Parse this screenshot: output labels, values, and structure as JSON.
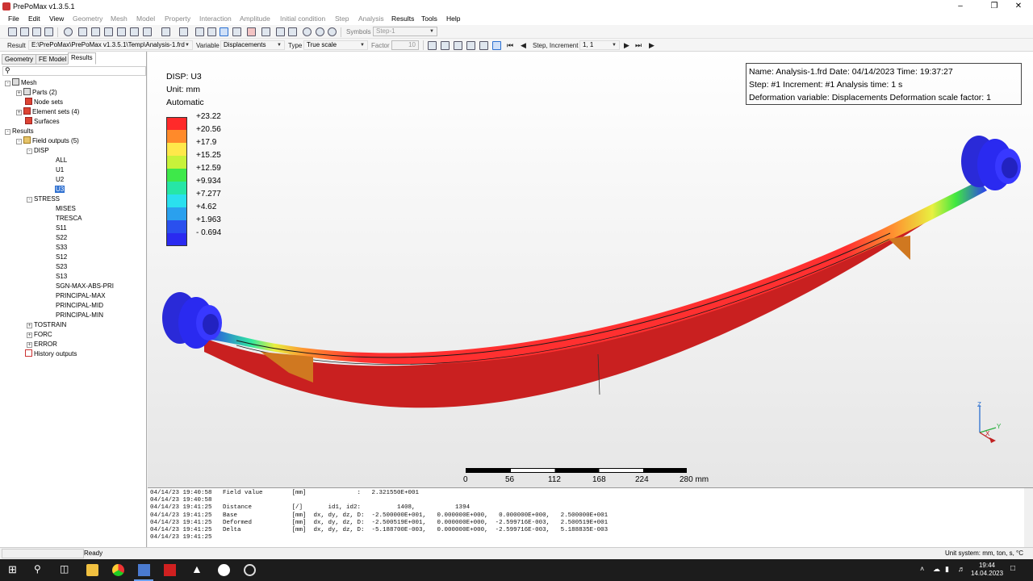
{
  "window": {
    "title": "PrePoMax v1.3.5.1",
    "minimize_icon": "minimize-icon",
    "maximize_icon": "restore-icon",
    "close_icon": "close-icon"
  },
  "menu": [
    "File",
    "Edit",
    "View",
    "Geometry",
    "Mesh",
    "Model",
    "Property",
    "Interaction",
    "Amplitude",
    "Initial condition",
    "Step",
    "Analysis",
    "Results",
    "Tools",
    "Help"
  ],
  "toolbar1": {
    "symbols_label": "Symbols",
    "step_value": "Step-1"
  },
  "toolbar2": {
    "result_label": "Result",
    "result_path": "E:\\PrePoMax\\PrePoMax v1.3.5.1\\Temp\\Analysis-1.frd",
    "variable_label": "Variable",
    "variable_value": "Displacements",
    "type_label": "Type",
    "type_value": "True scale",
    "factor_label": "Factor",
    "factor_value": "10",
    "step_inc_label": "Step, Increment",
    "step_inc_value": "1, 1"
  },
  "tabs": [
    "Geometry",
    "FE Model",
    "Results"
  ],
  "tree": {
    "mesh": "Mesh",
    "parts": "Parts (2)",
    "node_sets": "Node sets",
    "element_sets": "Element sets (4)",
    "surfaces": "Surfaces",
    "results": "Results",
    "field_outputs": "Field outputs (5)",
    "disp": "DISP",
    "disp_items": [
      "ALL",
      "U1",
      "U2",
      "U3"
    ],
    "stress": "STRESS",
    "stress_items": [
      "MISES",
      "TRESCA",
      "S11",
      "S22",
      "S33",
      "S12",
      "S23",
      "S13",
      "SGN-MAX-ABS-PRI",
      "PRINCIPAL-MAX",
      "PRINCIPAL-MID",
      "PRINCIPAL-MIN"
    ],
    "tostrain": "TOSTRAIN",
    "forc": "FORC",
    "error": "ERROR",
    "history_outputs": "History outputs"
  },
  "legend": {
    "title": "DISP: U3",
    "unit": "Unit: mm",
    "mode": "Automatic",
    "values": [
      "+23.22",
      "+20.56",
      "+17.9",
      "+15.25",
      "+12.59",
      "+9.934",
      "+7.277",
      "+4.62",
      "+1.963",
      "- 0.694"
    ],
    "colors": [
      "#ff2a2a",
      "#ff8a2a",
      "#ffe84a",
      "#c8f23a",
      "#3ee84a",
      "#26e6a6",
      "#2ae0ee",
      "#2aa0ee",
      "#2a50ee",
      "#2a2af0"
    ]
  },
  "info": {
    "line1": "Name: Analysis-1.frd   Date: 04/14/2023   Time: 19:37:27",
    "line2": "Step: #1   Increment: #1   Analysis time: 1 s",
    "line3": "Deformation variable: Displacements   Deformation scale factor: 1"
  },
  "scalebar": {
    "labels": [
      "0",
      "56",
      "112",
      "168",
      "224",
      "280 mm"
    ]
  },
  "triad": {
    "x": "X",
    "y": "Y",
    "z": "Z"
  },
  "console": [
    "04/14/23 19:40:58   Field value        [mm]              :   2.321550E+001",
    "04/14/23 19:40:58",
    "04/14/23 19:41:25   Distance           [/]       id1, id2:          1408,           1394",
    "04/14/23 19:41:25   Base               [mm]  dx, dy, dz, D:  -2.500000E+001,   0.000000E+000,   0.000000E+000,   2.500000E+001",
    "04/14/23 19:41:25   Deformed           [mm]  dx, dy, dz, D:  -2.500519E+001,   0.000000E+000,  -2.599716E-003,   2.500519E+001",
    "04/14/23 19:41:25   Delta              [mm]  dx, dy, dz, D:  -5.188700E-003,   0.000000E+000,  -2.599716E-003,   5.188835E-003",
    "04/14/23 19:41:25"
  ],
  "status": {
    "left": "Ready",
    "right": "Unit system: mm, ton, s, °C"
  },
  "taskbar": {
    "time": "19:44",
    "date": "14.04.2023"
  }
}
